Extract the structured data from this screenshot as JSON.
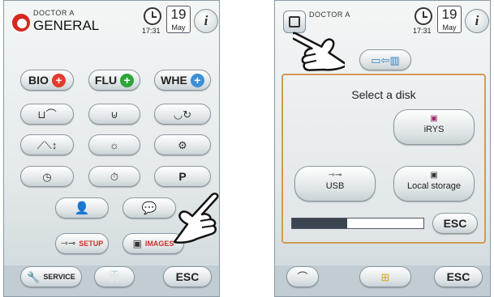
{
  "left_screen": {
    "header": {
      "doctor": "DOCTOR A",
      "specialty": "GENERAL",
      "time": "17:31",
      "day": "19",
      "month": "May",
      "info_label": "i"
    },
    "mode_buttons": [
      {
        "label": "BIO",
        "mark": "+",
        "color": "#e23b2d"
      },
      {
        "label": "FLU",
        "mark": "+",
        "color": "#2ea43a"
      },
      {
        "label": "WHE",
        "mark": "+",
        "color": "#3d8fd8"
      }
    ],
    "icon_rows": [
      [
        "cup-filler-icon",
        "cup-icon",
        "bowl-rinse-icon"
      ],
      [
        "chair-position-icon",
        "light-icon",
        "settings-gears-icon"
      ],
      [
        "clock-icon",
        "timer-icon",
        "program-p-icon"
      ]
    ],
    "program_label": "P",
    "user_buttons": [
      "assistant-user-icon",
      "message-bubble-icon"
    ],
    "setup_label": "SETUP",
    "images_label": "IMAGES",
    "service_label": "SERVICE",
    "esc_label": "ESC"
  },
  "right_screen": {
    "header": {
      "doctor": "DOCTOR A",
      "time": "17:31",
      "day": "19",
      "month": "May",
      "info_label": "i"
    },
    "dialog": {
      "title": "Select a disk",
      "disks": [
        {
          "label": "iRYS",
          "icon": "irys-icon"
        },
        {
          "label": "USB",
          "icon": "usb-icon"
        },
        {
          "label": "Local storage",
          "icon": "local-storage-icon"
        }
      ],
      "progress_fraction": 0.42,
      "esc_label": "ESC"
    },
    "footer_esc_label": "ESC"
  },
  "colors": {
    "accent_red": "#c8322a",
    "dialog_border": "#d19a55",
    "bottom_bar": "#c1cdd2"
  }
}
